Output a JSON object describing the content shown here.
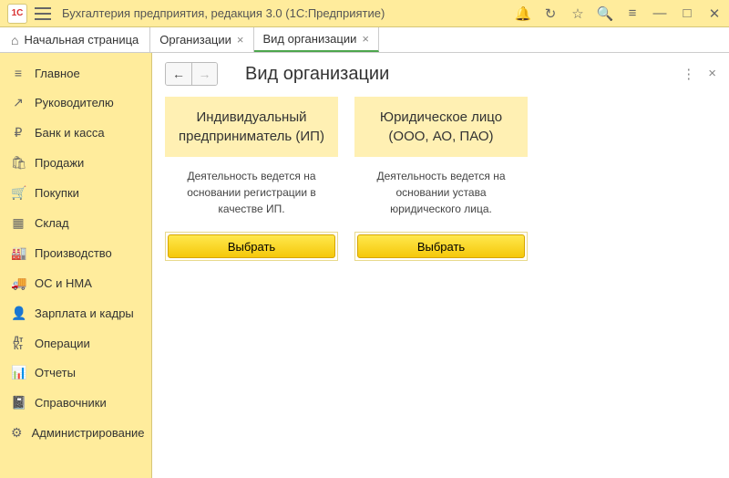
{
  "titlebar": {
    "logo_text": "1C",
    "title": "Бухгалтерия предприятия, редакция 3.0  (1С:Предприятие)"
  },
  "tabs": {
    "home": "Начальная страница",
    "items": [
      {
        "label": "Организации"
      },
      {
        "label": "Вид организации"
      }
    ]
  },
  "sidebar": {
    "items": [
      {
        "label": "Главное",
        "icon": "≡"
      },
      {
        "label": "Руководителю",
        "icon": "↗"
      },
      {
        "label": "Банк и касса",
        "icon": "₽"
      },
      {
        "label": "Продажи",
        "icon": "🛍"
      },
      {
        "label": "Покупки",
        "icon": "🛒"
      },
      {
        "label": "Склад",
        "icon": "▦"
      },
      {
        "label": "Производство",
        "icon": "🏭"
      },
      {
        "label": "ОС и НМА",
        "icon": "🚚"
      },
      {
        "label": "Зарплата и кадры",
        "icon": "👤"
      },
      {
        "label": "Операции",
        "icon": "ДтКт"
      },
      {
        "label": "Отчеты",
        "icon": "📊"
      },
      {
        "label": "Справочники",
        "icon": "📓"
      },
      {
        "label": "Администрирование",
        "icon": "⚙"
      }
    ]
  },
  "page": {
    "title": "Вид организации"
  },
  "cards": [
    {
      "header": "Индивидуальный предприниматель (ИП)",
      "desc": "Деятельность ведется на основании регистрации в качестве ИП.",
      "button": "Выбрать"
    },
    {
      "header": "Юридическое лицо (ООО, АО, ПАО)",
      "desc": "Деятельность ведется на основании устава юридического лица.",
      "button": "Выбрать"
    }
  ]
}
